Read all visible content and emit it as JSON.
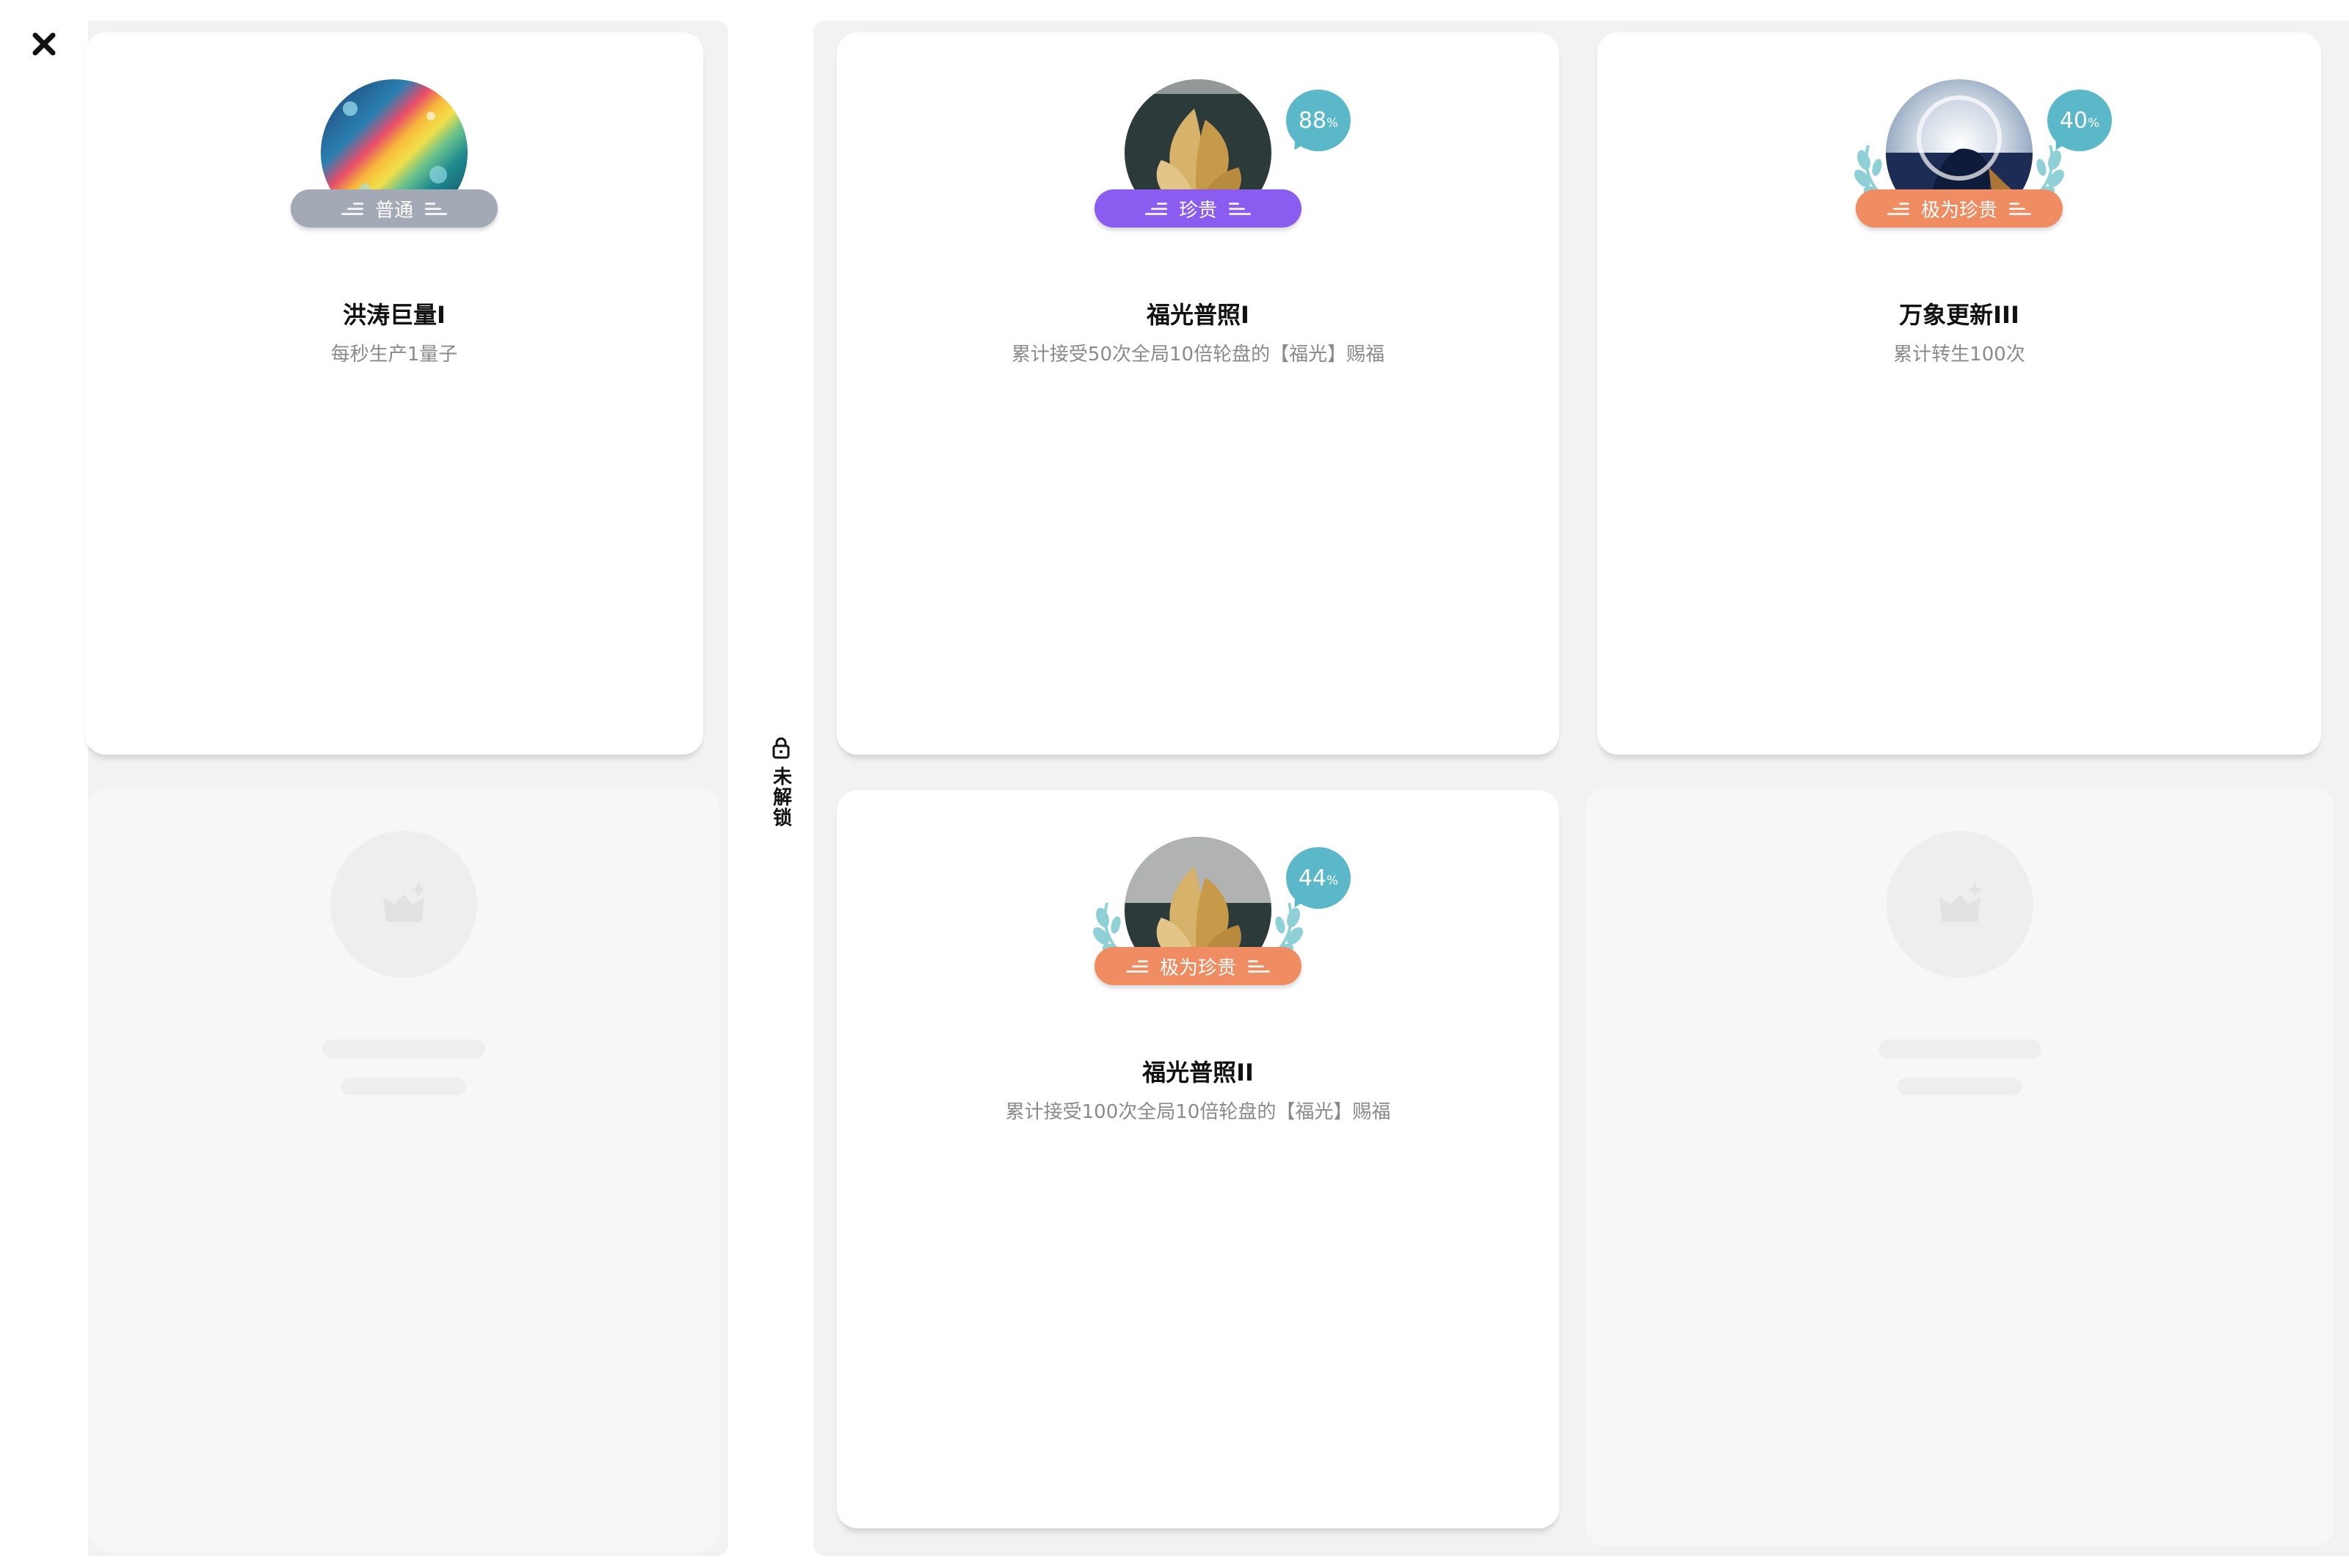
{
  "close_label": "close",
  "divider": {
    "label": "未解锁"
  },
  "cards": [
    {
      "name": "洪涛巨量I",
      "desc": "每秒生产1量子",
      "rarity": "普通",
      "rarity_color": "#a3a9b5"
    },
    {
      "name": "福光普照I",
      "desc": "累计接受50次全局10倍轮盘的【福光】赐福",
      "rarity": "珍贵",
      "rarity_color": "#8a5cf0",
      "percent": "88",
      "percent_unit": "%"
    },
    {
      "name": "万象更新III",
      "desc": "累计转生100次",
      "rarity": "极为珍贵",
      "rarity_color": "#ef8c62",
      "percent": "40",
      "percent_unit": "%"
    },
    {
      "name": "福光普照II",
      "desc": "累计接受100次全局10倍轮盘的【福光】赐福",
      "rarity": "极为珍贵",
      "rarity_color": "#ef8c62",
      "percent": "44",
      "percent_unit": "%"
    }
  ],
  "colors": {
    "badge": "#5bb8c8",
    "laurel": "#8fd0d6",
    "panel": "#f2f2f2"
  }
}
